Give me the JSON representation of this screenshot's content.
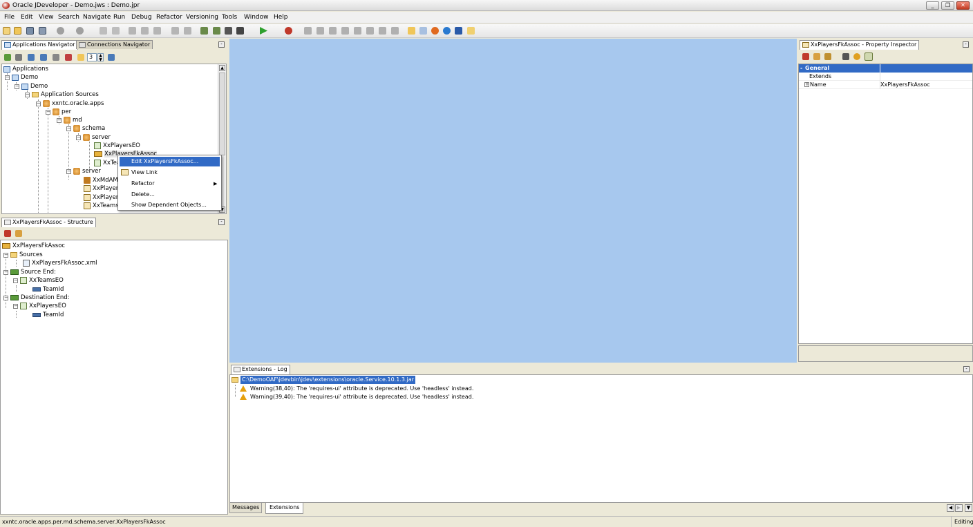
{
  "window": {
    "title": "Oracle JDeveloper - Demo.jws : Demo.jpr",
    "buttons": [
      "_",
      "❐",
      "✕"
    ]
  },
  "menu": [
    "File",
    "Edit",
    "View",
    "Search",
    "Navigate",
    "Run",
    "Debug",
    "Refactor",
    "Versioning",
    "Tools",
    "Window",
    "Help"
  ],
  "nav_panel": {
    "tabs": [
      "Applications Navigator",
      "Connections Navigator"
    ],
    "level": "3",
    "tree": {
      "root": "Applications",
      "workspace": "Demo",
      "project": "Demo",
      "app_sources": "Application Sources",
      "pkg_xxntc": "xxntc.oracle.apps",
      "pkg_per": "per",
      "pkg_md": "md",
      "pkg_schema": "schema",
      "pkg_server_1": "server",
      "obj_players_eo": "XxPlayersEO",
      "obj_fkassoc": "XxPlayersFkAssoc",
      "obj_teams_eo": "XxTeamsEO",
      "pkg_server_2": "server",
      "obj_mdam": "XxMdAM",
      "obj_players_1": "XxPlayersF",
      "obj_players_2": "XxPlayersF",
      "obj_teams_vo": "XxTeamsE"
    }
  },
  "context_menu": {
    "items": [
      "Edit XxPlayersFkAssoc...",
      "View Link",
      "Refactor",
      "Delete...",
      "Show Dependent Objects..."
    ]
  },
  "structure_panel": {
    "tab": "XxPlayersFkAssoc - Structure",
    "tree": {
      "root": "XxPlayersFkAssoc",
      "sources": "Sources",
      "xml_file": "XxPlayersFkAssoc.xml",
      "source_end": "Source End:",
      "source_eo": "XxTeamsEO",
      "source_attr": "TeamId",
      "dest_end": "Destination End:",
      "dest_eo": "XxPlayersEO",
      "dest_attr": "TeamId"
    }
  },
  "property_inspector": {
    "tab": "XxPlayersFkAssoc - Property Inspector",
    "section": "General",
    "rows": [
      {
        "name": "Extends",
        "value": ""
      },
      {
        "name": "Name",
        "value": "XxPlayersFkAssoc"
      }
    ]
  },
  "log_panel": {
    "tab": "Extensions - Log",
    "path": "C:\\DemoOAF\\jdevbin\\jdev\\extensions\\oracle.Service.10.1.3.jar",
    "warnings": [
      "Warning(38,40): The 'requires-ui' attribute is deprecated. Use 'headless' instead.",
      "Warning(39,40): The 'requires-ui' attribute is deprecated. Use 'headless' instead."
    ],
    "bottom_tabs": [
      "Messages",
      "Extensions"
    ]
  },
  "status": {
    "path": "xxntc.oracle.apps.per.md.schema.server.XxPlayersFkAssoc",
    "mode": "Editing"
  },
  "colors": {
    "editor_bg": "#a7c8ee",
    "selection": "#316ac5"
  }
}
